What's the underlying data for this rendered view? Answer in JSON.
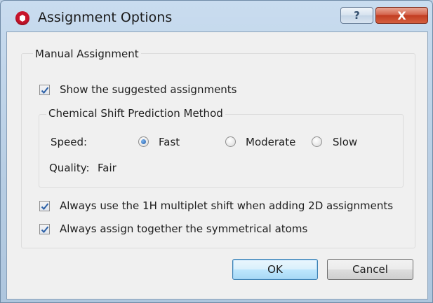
{
  "window": {
    "title": "Assignment Options",
    "help_label": "?",
    "close_label": "X"
  },
  "manual_assignment": {
    "group_title": "Manual Assignment",
    "show_suggested": {
      "label": "Show the suggested assignments",
      "checked": true
    }
  },
  "prediction": {
    "group_title": "Chemical Shift Prediction Method",
    "speed_label": "Speed:",
    "options": [
      {
        "label": "Fast",
        "selected": true
      },
      {
        "label": "Moderate",
        "selected": false
      },
      {
        "label": "Slow",
        "selected": false
      }
    ],
    "quality_label": "Quality:",
    "quality_value": "Fair"
  },
  "options": {
    "multiplet_shift": {
      "label": "Always use the 1H multiplet shift when adding 2D assignments",
      "checked": true
    },
    "symmetrical_atoms": {
      "label": "Always assign together the symmetrical atoms",
      "checked": true
    }
  },
  "buttons": {
    "ok": "OK",
    "cancel": "Cancel"
  },
  "colors": {
    "close_red": "#c23d22",
    "check_blue": "#2a5fa6",
    "app_icon_red": "#c8142b"
  }
}
